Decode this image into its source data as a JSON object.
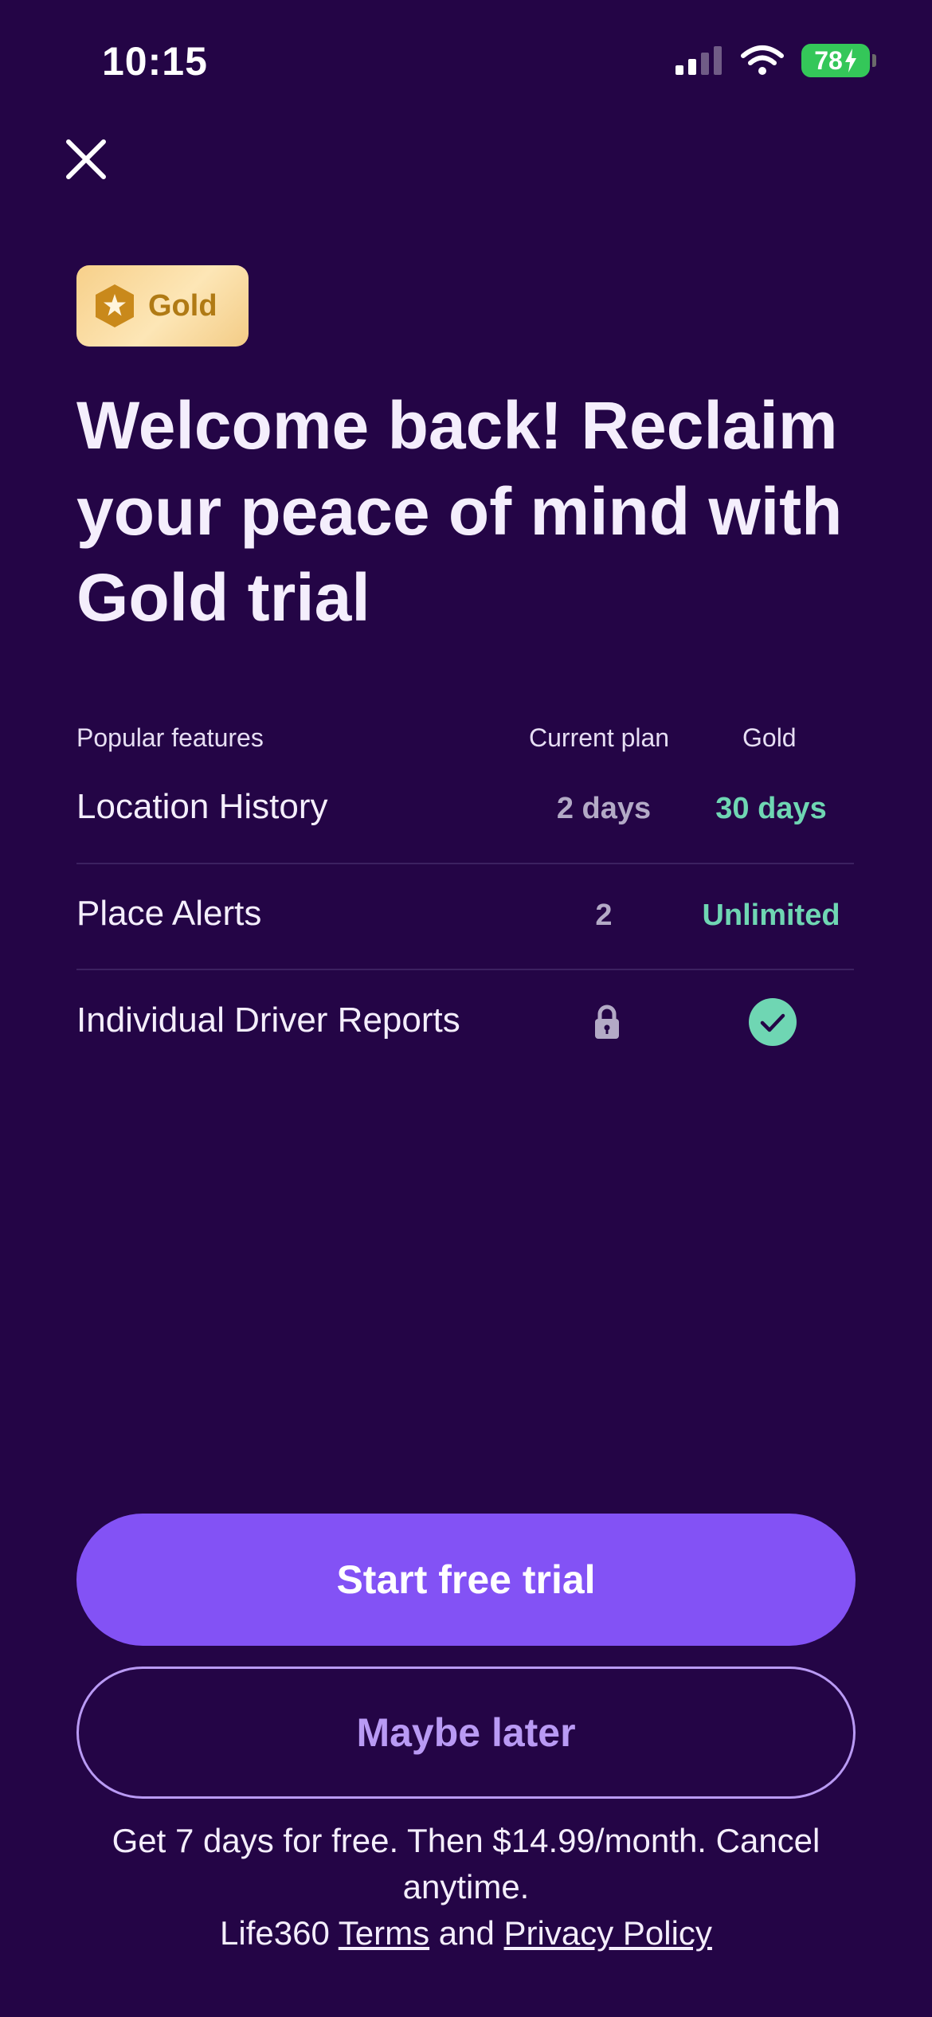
{
  "status_bar": {
    "time": "10:15",
    "battery": "78",
    "icons": [
      "cellular-signal-icon",
      "wifi-icon",
      "battery-charging-icon"
    ]
  },
  "header": {
    "close_icon": "close-icon"
  },
  "badge": {
    "icon": "star-hexagon-icon",
    "label": "Gold"
  },
  "headline": "Welcome back! Reclaim your peace of mind with Gold trial",
  "comparison": {
    "headers": {
      "feature": "Popular features",
      "current": "Current plan",
      "gold": "Gold"
    },
    "rows": [
      {
        "feature": "Location History",
        "current": "2 days",
        "gold": "30 days"
      },
      {
        "feature": "Place Alerts",
        "current": "2",
        "gold": "Unlimited"
      },
      {
        "feature": "Individual Driver Reports",
        "current_icon": "lock-icon",
        "gold_icon": "check-circle-icon"
      }
    ]
  },
  "actions": {
    "primary": "Start free trial",
    "secondary": "Maybe later"
  },
  "footer": {
    "pricing": "Get 7 days for free. Then $14.99/month. Cancel anytime.",
    "brand": "Life360",
    "terms": "Terms",
    "and": "and",
    "privacy": "Privacy Policy"
  },
  "colors": {
    "background": "#240546",
    "primary_button": "#8352f5",
    "accent_green": "#6fd6b3",
    "gold_badge": "#f7d08a"
  }
}
